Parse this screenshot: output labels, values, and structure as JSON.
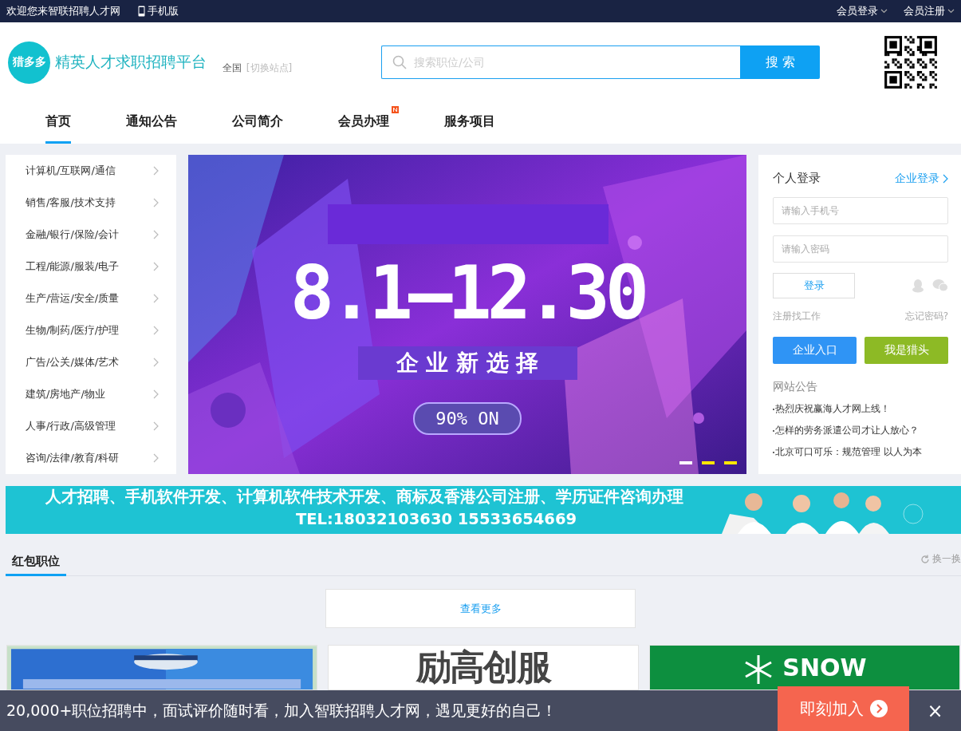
{
  "top_bar": {
    "welcome": "欢迎您来智联招聘人才网",
    "mobile": "手机版",
    "links": [
      "会员登录",
      "会员注册"
    ]
  },
  "header": {
    "logo_badge": "猎多多",
    "slogan": "精英人才求职招聘平台",
    "city": "全国",
    "switch_city": "[切换站点]",
    "search": {
      "placeholder": "搜索职位/公司",
      "button": "搜 索"
    }
  },
  "nav": [
    {
      "label": "首页",
      "selected": true,
      "new": false
    },
    {
      "label": "通知公告",
      "selected": false,
      "new": false
    },
    {
      "label": "公司简介",
      "selected": false,
      "new": false
    },
    {
      "label": "会员办理",
      "selected": false,
      "new": true
    },
    {
      "label": "服务项目",
      "selected": false,
      "new": false
    }
  ],
  "categories": [
    "计算机/互联网/通信",
    "销售/客服/技术支持",
    "金融/银行/保险/会计",
    "工程/能源/服装/电子",
    "生产/营运/安全/质量",
    "生物/制药/医疗/护理",
    "广告/公关/媒体/艺术",
    "建筑/房地产/物业",
    "人事/行政/高级管理",
    "咨询/法律/教育/科研"
  ],
  "banner": {
    "headline": "8.1—12.30",
    "subline": "企 业 新 选 择",
    "badge": "90% ON",
    "dots": [
      {
        "selected": true
      },
      {
        "selected": false
      },
      {
        "selected": false
      }
    ]
  },
  "login": {
    "title": "个人登录",
    "company_link": "企业登录",
    "phone_placeholder": "请输入手机号",
    "password_placeholder": "请输入密码",
    "submit": "登录",
    "register": "注册找工作",
    "forgot": "忘记密码?",
    "company_button": "企业入口",
    "hunter_button": "我是猎头",
    "notice_title": "网站公告",
    "notices": [
      "热烈庆祝赢海人才网上线！",
      "怎样的劳务派遣公司才让人放心？",
      "北京可口可乐：规范管理 以人为本"
    ]
  },
  "ad_strip": {
    "line1": "人才招聘、手机软件开发、计算机软件技术开发、商标及香港公司注册、学历证件咨询办理",
    "line2": "TEL:18032103630   15533654669"
  },
  "section": {
    "title": "红包职位",
    "refresh": "换一换",
    "more": "查看更多"
  },
  "companies": [
    {
      "kind": "picture"
    },
    {
      "kind": "wordmark",
      "text": "励高创服"
    },
    {
      "kind": "snow",
      "text": "SNOW"
    }
  ],
  "footer_bar": {
    "text": "20,000+职位招聘中，面试评价随时看，加入智联招聘人才网，遇见更好的自己！",
    "join": "即刻加入",
    "close": "×"
  }
}
